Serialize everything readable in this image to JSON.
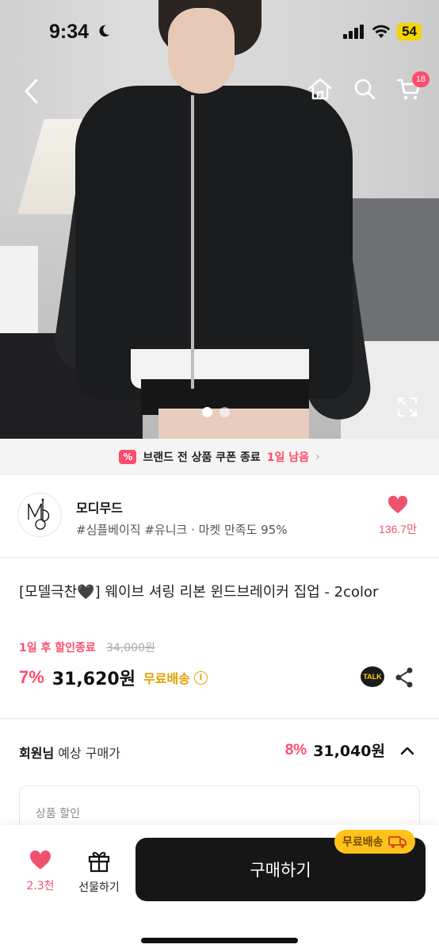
{
  "status_bar": {
    "time": "9:34",
    "battery": "54"
  },
  "nav": {
    "cart_count": "18"
  },
  "gallery": {
    "total_images": 2,
    "active_index": 0
  },
  "coupon_banner": {
    "icon_text": "%",
    "prefix": "브랜드 전 상품 쿠폰 종료",
    "highlight": "1일 남음",
    "chevron": "›"
  },
  "brand": {
    "logo_text": "MD",
    "name": "모디무드",
    "subtitle": "#심플베이직 #유니크 · 마켓 만족도 95%",
    "like_count": "136.7만"
  },
  "product": {
    "title": "[모델극찬🖤] 웨이브 셔링 리본 윈드브레이커 집업 - 2color",
    "discount_end": "1일 후 할인종료",
    "original_price": "34,000원",
    "discount_pct": "7%",
    "price": "31,620원",
    "free_shipping": "무료배송",
    "info_icon": "i",
    "kakao_talk": "TALK"
  },
  "member_price": {
    "label_bold": "회원님",
    "label_rest": " 예상 구매가",
    "discount_pct": "8%",
    "price": "31,040원"
  },
  "discount_box": {
    "label": "상품 할인"
  },
  "bottom_bar": {
    "like_count": "2.3천",
    "gift_label": "선물하기",
    "buy_label": "구매하기",
    "ship_badge": "무료배송"
  },
  "colors": {
    "accent": "#ff4d6d",
    "ship_yellow": "#ffc21a",
    "buy_button": "#161616"
  }
}
